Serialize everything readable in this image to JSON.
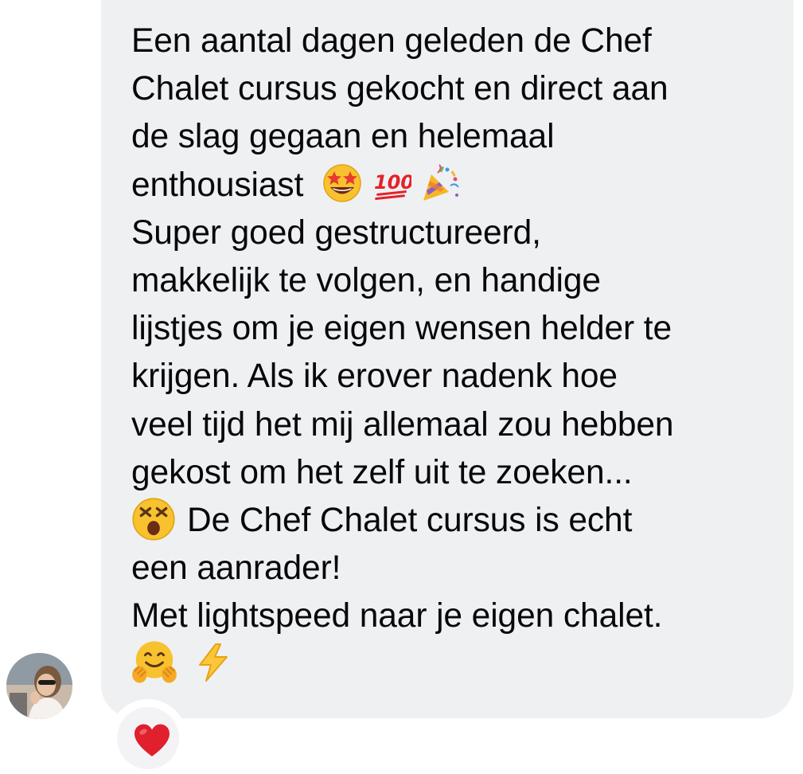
{
  "message": {
    "lines": [
      "Een aantal dagen geleden de Chef",
      "Chalet cursus gekocht en direct aan",
      "de slag gegaan en helemaal",
      "enthousiast",
      "Super goed gestructureerd,",
      "makkelijk te volgen, en handige",
      "lijstjes om je eigen wensen helder te",
      "krijgen. Als ik erover nadenk hoe",
      "veel tijd het mij allemaal zou hebben",
      "gekost om het zelf uit te zoeken...",
      "De Chef Chalet cursus is echt",
      "een aanrader!",
      "Met lightspeed naar je eigen chalet."
    ],
    "emojis": {
      "line4": [
        "star-struck-emoji",
        "hundred-points-emoji",
        "party-popper-emoji"
      ],
      "line11": [
        "dizzy-face-emoji"
      ],
      "last": [
        "hugging-face-emoji",
        "high-voltage-emoji"
      ]
    }
  },
  "reaction": {
    "icon": "red-heart-icon"
  },
  "colors": {
    "bubble_bg": "#eff0f2",
    "text": "#080809",
    "heart": "#e0202d"
  }
}
